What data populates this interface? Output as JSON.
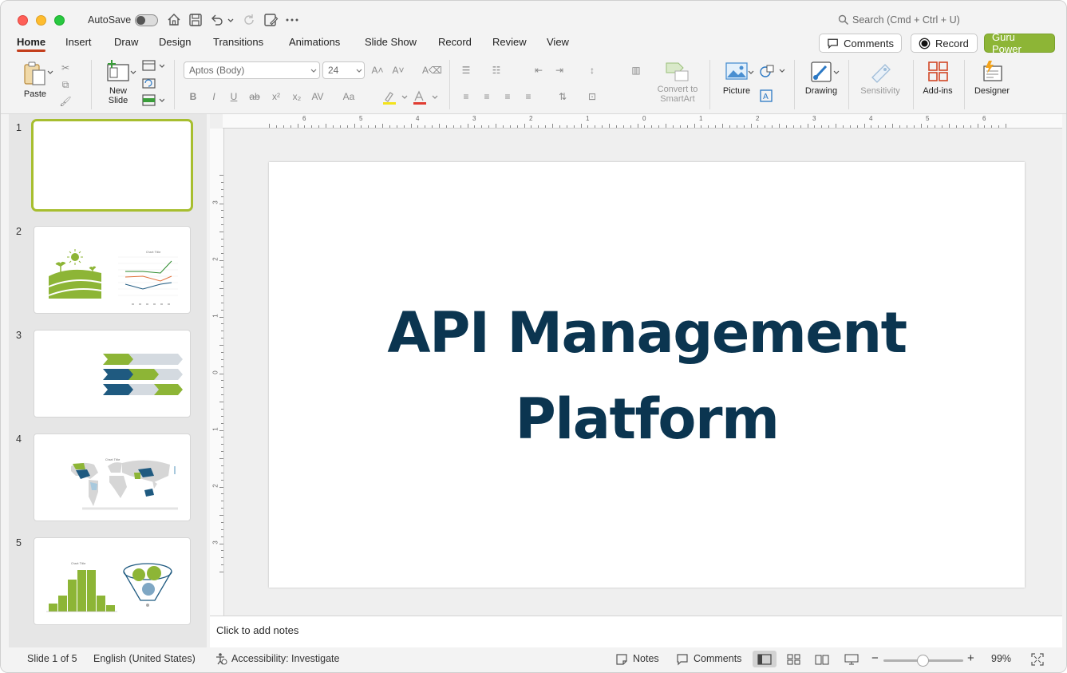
{
  "titlebar": {
    "autosave_label": "AutoSave",
    "search_placeholder": "Search (Cmd + Ctrl + U)"
  },
  "tabs": [
    {
      "label": "Home",
      "active": true
    },
    {
      "label": "Insert"
    },
    {
      "label": "Draw"
    },
    {
      "label": "Design"
    },
    {
      "label": "Transitions"
    },
    {
      "label": "Animations"
    },
    {
      "label": "Slide Show"
    },
    {
      "label": "Record"
    },
    {
      "label": "Review"
    },
    {
      "label": "View"
    }
  ],
  "actions": {
    "comments_label": "Comments",
    "record_label": "Record",
    "guru_label": "Guru Power",
    "guru_color": "#8db536"
  },
  "ribbon": {
    "paste": "Paste",
    "new_slide_line1": "New",
    "new_slide_line2": "Slide",
    "font_name": "Aptos (Body)",
    "font_size": "24",
    "convert_line1": "Convert to",
    "convert_line2": "SmartArt",
    "picture": "Picture",
    "drawing": "Drawing",
    "sensitivity": "Sensitivity",
    "addins": "Add-ins",
    "designer": "Designer"
  },
  "slides": [
    {
      "number": "1"
    },
    {
      "number": "2"
    },
    {
      "number": "3"
    },
    {
      "number": "4"
    },
    {
      "number": "5"
    }
  ],
  "current_slide": {
    "title_line1": "API Management",
    "title_line2": "Platform",
    "title_color": "#0b3550"
  },
  "notes": {
    "placeholder": "Click to add notes"
  },
  "statusbar": {
    "slide_info": "Slide 1 of 5",
    "language": "English (United States)",
    "accessibility": "Accessibility: Investigate",
    "notes": "Notes",
    "comments": "Comments",
    "zoom": "99%"
  },
  "ruler": {
    "h_labels": [
      "6",
      "5",
      "4",
      "3",
      "2",
      "1",
      "0",
      "1",
      "2",
      "3",
      "4",
      "5",
      "6"
    ],
    "v_labels": [
      "3",
      "2",
      "1",
      "0",
      "1",
      "2",
      "3"
    ]
  },
  "accent": "#a7be2f"
}
